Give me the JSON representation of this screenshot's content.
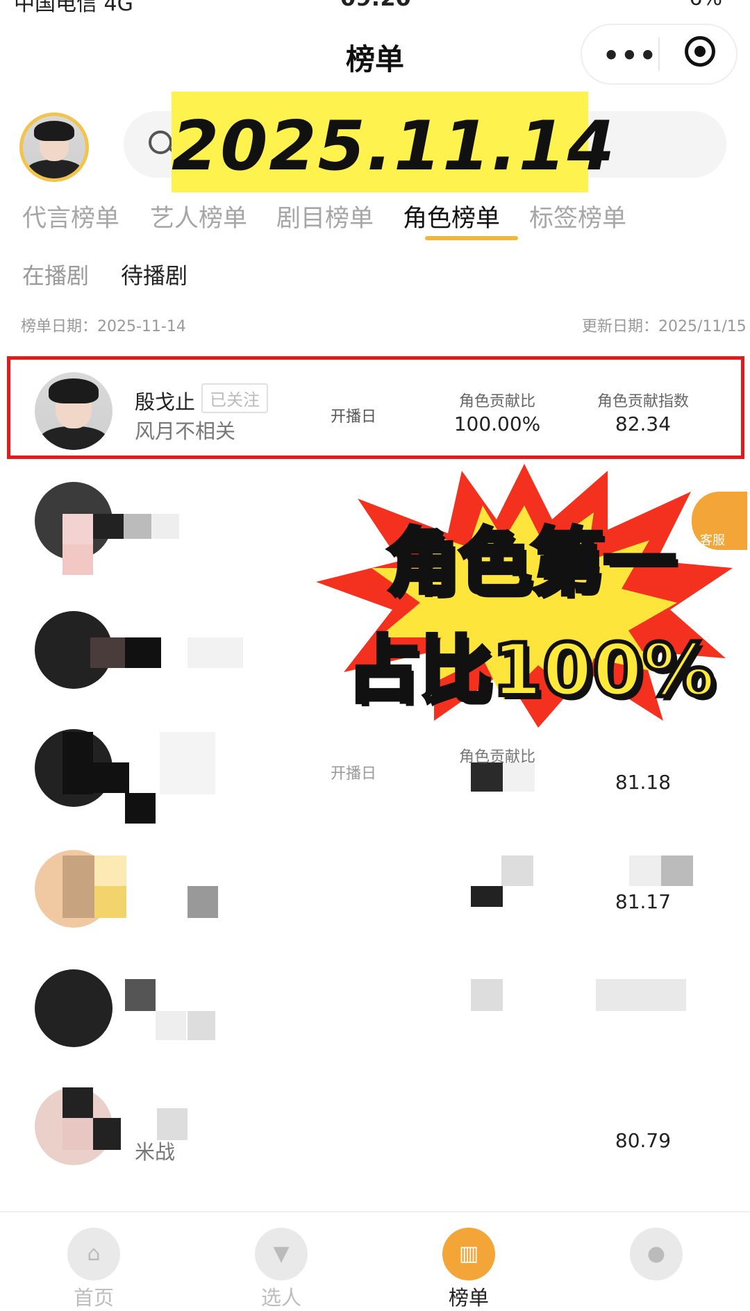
{
  "status_bar": {
    "carrier": "中国电信 4G",
    "time": "09:20",
    "battery": "6%"
  },
  "nav": {
    "title": "榜单",
    "more_icon": "more-dots-icon",
    "close_icon": "target-icon"
  },
  "date_banner": "2025.11.14",
  "tabs": [
    {
      "label": "代言榜单"
    },
    {
      "label": "艺人榜单"
    },
    {
      "label": "剧目榜单"
    },
    {
      "label": "角色榜单"
    },
    {
      "label": "标签榜单"
    }
  ],
  "subtabs": [
    {
      "label": "在播剧"
    },
    {
      "label": "待播剧"
    }
  ],
  "dates": {
    "list_date": "榜单日期：2025-11-14",
    "update_date": "更新日期：2025/11/15"
  },
  "rows": [
    {
      "name": "殷戈止",
      "show": "风月不相关",
      "follow": "已关注",
      "start": "开播日",
      "ratio_label": "角色贡献比",
      "ratio": "100.00%",
      "index_label": "角色贡献指数",
      "index": "82.34"
    },
    {
      "index": "81.18",
      "ratio_label": "角色贡献比",
      "start": "开播日"
    },
    {
      "index": "81.17"
    },
    {
      "index": "80.79",
      "show": "米战"
    }
  ],
  "overlay": {
    "line1": "角色第一",
    "line2": "占比100%"
  },
  "service": {
    "label": "客服"
  },
  "tabbar": [
    {
      "label": "首页",
      "icon": "home-icon"
    },
    {
      "label": "选人",
      "icon": "filter-icon"
    },
    {
      "label": "榜单",
      "icon": "chart-icon"
    },
    {
      "label": "",
      "icon": "person-icon"
    }
  ],
  "colors": {
    "accent": "#f0b73c",
    "highlight": "#e21b1b",
    "banner": "#fef24e"
  }
}
